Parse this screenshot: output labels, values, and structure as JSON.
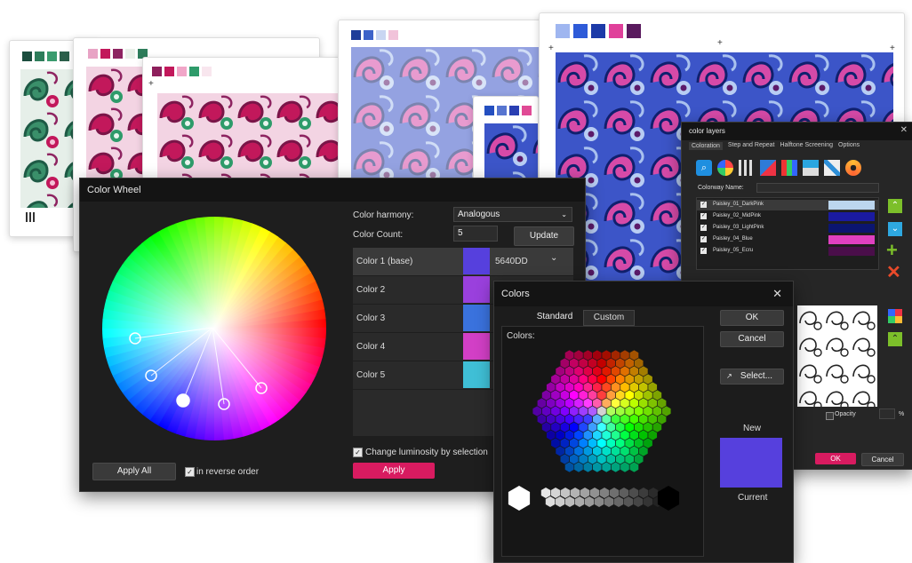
{
  "cards": {
    "green": {
      "swatches": [
        "#1b4d3e",
        "#2e7d5b",
        "#3a9b6e",
        "#2b5f4a"
      ]
    },
    "pink": {
      "swatches": [
        "#e8a3c5",
        "#c2185b",
        "#8e2461",
        "#e9f0e9",
        "#2e7d5b"
      ]
    },
    "mid": {
      "swatches": [
        "#8e1f5c",
        "#c2185b",
        "#f1a6c8",
        "#2e9b6a",
        "#f8e6ee"
      ]
    },
    "blue1": {
      "swatches": [
        "#1f3d99",
        "#3d63c9",
        "#c9d6f2",
        "#f1c3da"
      ]
    },
    "blue2": {
      "swatches": [
        "#244fc0",
        "#5775d0",
        "#2a3fb3",
        "#e04a95"
      ]
    },
    "big": {
      "swatches": [
        "#9fb6f0",
        "#2e5bd8",
        "#1c3aa8",
        "#e0409a",
        "#5a1a5e"
      ]
    }
  },
  "color_wheel": {
    "title": "Color Wheel",
    "harmony_label": "Color harmony:",
    "harmony_value": "Analogous",
    "count_label": "Color Count:",
    "count_value": "5",
    "update_label": "Update",
    "colors": [
      {
        "name": "Color 1 (base)",
        "hex": "5640DD",
        "swatch": "#5640DD"
      },
      {
        "name": "Color 2",
        "hex": "",
        "swatch": "#9a40dd"
      },
      {
        "name": "Color 3",
        "hex": "",
        "swatch": "#3a72dd"
      },
      {
        "name": "Color 4",
        "hex": "",
        "swatch": "#d23fc6"
      },
      {
        "name": "Color 5",
        "hex": "",
        "swatch": "#3fbfd6"
      }
    ],
    "apply_all_label": "Apply All",
    "reverse_label": "in reverse order",
    "luminosity_label": "Change luminosity by selection",
    "apply_label": "Apply"
  },
  "color_layers": {
    "title": "color layers",
    "tabs": [
      "Coloration",
      "Step and Repeat",
      "Halftone Screening",
      "Options"
    ],
    "colorway_label": "Colorway Name:",
    "layers": [
      {
        "name": "Paisley_01_DarkPink",
        "color": "#bcd6ee"
      },
      {
        "name": "Paisley_02_MidPink",
        "color": "#1a1aa0"
      },
      {
        "name": "Paisley_03_LightPink",
        "color": "#0b1570"
      },
      {
        "name": "Paisley_04_Blue",
        "color": "#e040c0"
      },
      {
        "name": "Paisley_05_Ecru",
        "color": "#4a0e4a"
      }
    ],
    "opacity_label": "Opacity",
    "percent": "%",
    "ok_label": "OK",
    "cancel_label": "Cancel"
  },
  "colors_dialog": {
    "title": "Colors",
    "tab_standard": "Standard",
    "tab_custom": "Custom",
    "colors_label": "Colors:",
    "ok_label": "OK",
    "cancel_label": "Cancel",
    "select_label": "Select...",
    "new_label": "New",
    "current_label": "Current",
    "new_color": "#5640DD"
  }
}
